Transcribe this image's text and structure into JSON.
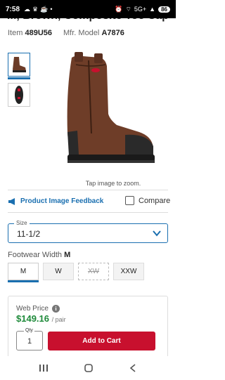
{
  "status": {
    "time": "7:58",
    "network": "5G+",
    "battery": "86"
  },
  "product": {
    "title_partial": "M, Brown, Composite Toe Cap",
    "item_label": "Item",
    "item_number": "489U56",
    "mfr_label": "Mfr. Model",
    "mfr_model": "A7876"
  },
  "gallery": {
    "zoom_hint": "Tap image to zoom.",
    "thumbnails": [
      "boot-side-thumbnail",
      "boot-sole-thumbnail"
    ]
  },
  "feedback": {
    "label": "Product Image Feedback"
  },
  "compare": {
    "label": "Compare"
  },
  "size": {
    "label": "Size",
    "value": "11-1/2"
  },
  "width": {
    "label": "Footwear Width",
    "selected": "M",
    "options": [
      "M",
      "W",
      "XW",
      "XXW"
    ]
  },
  "pricing": {
    "label": "Web Price",
    "price": "$149.16",
    "unit": "/ pair",
    "qty_label": "Qty",
    "qty_value": "1",
    "add_to_cart": "Add to Cart"
  },
  "colors": {
    "accent": "#1a6fb0",
    "cart": "#c8102e",
    "price": "#1e8a3a"
  }
}
